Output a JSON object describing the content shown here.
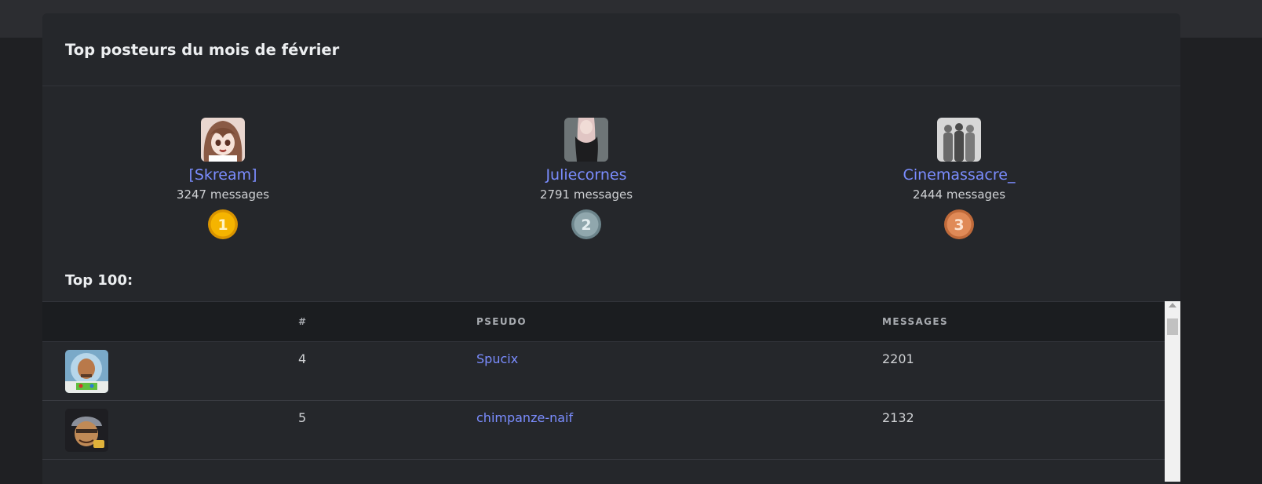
{
  "page": {
    "title": "Top posteurs du mois de février"
  },
  "podium": [
    {
      "rank": 1,
      "name": "[Skream]",
      "messages": "3247 messages",
      "medal_color": "#f5b400",
      "medal_rim": "#d99400",
      "avatar_icon": "anime-girl-avatar"
    },
    {
      "rank": 2,
      "name": "Juliecornes",
      "messages": "2791 messages",
      "medal_color": "#90a7ad",
      "medal_rim": "#6c848b",
      "avatar_icon": "girl-photo-avatar"
    },
    {
      "rank": 3,
      "name": "Cinemassacre_",
      "messages": "2444 messages",
      "medal_color": "#e08a57",
      "medal_rim": "#c06a3a",
      "avatar_icon": "silhouettes-avatar"
    }
  ],
  "top100": {
    "label": "Top 100:",
    "columns": [
      "",
      "#",
      "PSEUDO",
      "MESSAGES"
    ],
    "rows": [
      {
        "rank": "4",
        "pseudo": "Spucix",
        "messages": "2201",
        "avatar_icon": "space-ranger-avatar"
      },
      {
        "rank": "5",
        "pseudo": "chimpanze-naif",
        "messages": "2132",
        "avatar_icon": "helmet-man-avatar"
      }
    ]
  },
  "colors": {
    "background": "#1f2023",
    "card": "#25272b",
    "link": "#7b8dff"
  }
}
